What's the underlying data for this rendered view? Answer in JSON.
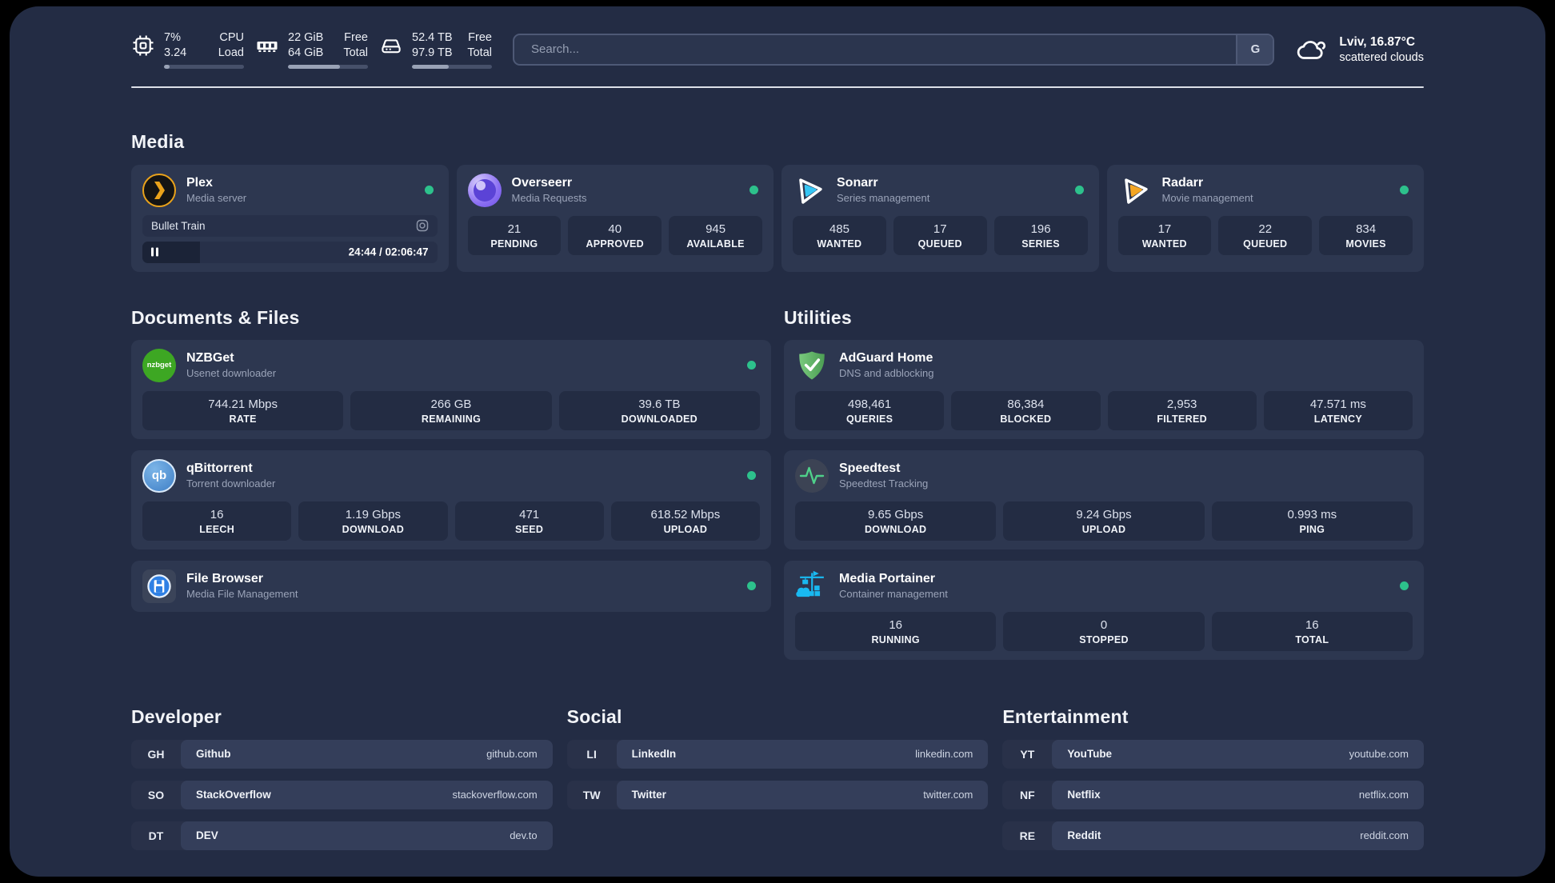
{
  "colors": {
    "status_online": "#2dc18c",
    "plex_amber": "#e9a21b",
    "sonarr_blue": "#37c6f4",
    "radarr_yellow": "#f5a623",
    "nzbget_green": "#3da723",
    "qbittorrent_blue": "#4b90d6",
    "adguard_green": "#5fb463",
    "speedtest_green": "#4fd08a",
    "portainer_blue": "#19b9f1"
  },
  "header": {
    "system_stats": [
      {
        "name": "cpu",
        "value_top": "7%",
        "label_top": "CPU",
        "value_bottom": "3.24",
        "label_bottom": "Load",
        "progress_pct": 7
      },
      {
        "name": "memory",
        "value_top": "22 GiB",
        "label_top": "Free",
        "value_bottom": "64 GiB",
        "label_bottom": "Total",
        "progress_pct": 65
      },
      {
        "name": "disk",
        "value_top": "52.4 TB",
        "label_top": "Free",
        "value_bottom": "97.9 TB",
        "label_bottom": "Total",
        "progress_pct": 46
      }
    ],
    "search": {
      "placeholder": "Search...",
      "engine_button": "G"
    },
    "weather": {
      "location": "Lviv, 16.87°C",
      "condition": "scattered clouds"
    }
  },
  "sections": {
    "media": {
      "title": "Media",
      "cards": [
        {
          "app": "Plex",
          "description": "Media server",
          "now_playing": {
            "title": "Bullet Train",
            "time_display": "24:44 / 02:06:47",
            "progress_pct": 19.5
          }
        },
        {
          "app": "Overseerr",
          "description": "Media Requests",
          "stats": [
            {
              "value": "21",
              "label": "PENDING"
            },
            {
              "value": "40",
              "label": "APPROVED"
            },
            {
              "value": "945",
              "label": "AVAILABLE"
            }
          ]
        },
        {
          "app": "Sonarr",
          "description": "Series management",
          "stats": [
            {
              "value": "485",
              "label": "WANTED"
            },
            {
              "value": "17",
              "label": "QUEUED"
            },
            {
              "value": "196",
              "label": "SERIES"
            }
          ]
        },
        {
          "app": "Radarr",
          "description": "Movie management",
          "stats": [
            {
              "value": "17",
              "label": "WANTED"
            },
            {
              "value": "22",
              "label": "QUEUED"
            },
            {
              "value": "834",
              "label": "MOVIES"
            }
          ]
        }
      ]
    },
    "documents": {
      "title": "Documents & Files",
      "cards": [
        {
          "app": "NZBGet",
          "description": "Usenet downloader",
          "stats": [
            {
              "value": "744.21 Mbps",
              "label": "RATE"
            },
            {
              "value": "266 GB",
              "label": "REMAINING"
            },
            {
              "value": "39.6 TB",
              "label": "DOWNLOADED"
            }
          ]
        },
        {
          "app": "qBittorrent",
          "description": "Torrent downloader",
          "stats": [
            {
              "value": "16",
              "label": "LEECH"
            },
            {
              "value": "1.19 Gbps",
              "label": "DOWNLOAD"
            },
            {
              "value": "471",
              "label": "SEED"
            },
            {
              "value": "618.52 Mbps",
              "label": "UPLOAD"
            }
          ]
        },
        {
          "app": "File Browser",
          "description": "Media File Management",
          "stats": []
        }
      ]
    },
    "utilities": {
      "title": "Utilities",
      "cards": [
        {
          "app": "AdGuard Home",
          "description": "DNS and adblocking",
          "stats": [
            {
              "value": "498,461",
              "label": "QUERIES"
            },
            {
              "value": "86,384",
              "label": "BLOCKED"
            },
            {
              "value": "2,953",
              "label": "FILTERED"
            },
            {
              "value": "47.571 ms",
              "label": "LATENCY"
            }
          ]
        },
        {
          "app": "Speedtest",
          "description": "Speedtest Tracking",
          "stats": [
            {
              "value": "9.65 Gbps",
              "label": "DOWNLOAD"
            },
            {
              "value": "9.24 Gbps",
              "label": "UPLOAD"
            },
            {
              "value": "0.993 ms",
              "label": "PING"
            }
          ]
        },
        {
          "app": "Media Portainer",
          "description": "Container management",
          "stats": [
            {
              "value": "16",
              "label": "RUNNING"
            },
            {
              "value": "0",
              "label": "STOPPED"
            },
            {
              "value": "16",
              "label": "TOTAL"
            }
          ]
        }
      ]
    },
    "links": {
      "developer": {
        "title": "Developer",
        "items": [
          {
            "abbr": "GH",
            "name": "Github",
            "domain": "github.com"
          },
          {
            "abbr": "SO",
            "name": "StackOverflow",
            "domain": "stackoverflow.com"
          },
          {
            "abbr": "DT",
            "name": "DEV",
            "domain": "dev.to"
          }
        ]
      },
      "social": {
        "title": "Social",
        "items": [
          {
            "abbr": "LI",
            "name": "LinkedIn",
            "domain": "linkedin.com"
          },
          {
            "abbr": "TW",
            "name": "Twitter",
            "domain": "twitter.com"
          }
        ]
      },
      "entertainment": {
        "title": "Entertainment",
        "items": [
          {
            "abbr": "YT",
            "name": "YouTube",
            "domain": "youtube.com"
          },
          {
            "abbr": "NF",
            "name": "Netflix",
            "domain": "netflix.com"
          },
          {
            "abbr": "RE",
            "name": "Reddit",
            "domain": "reddit.com"
          }
        ]
      }
    }
  }
}
